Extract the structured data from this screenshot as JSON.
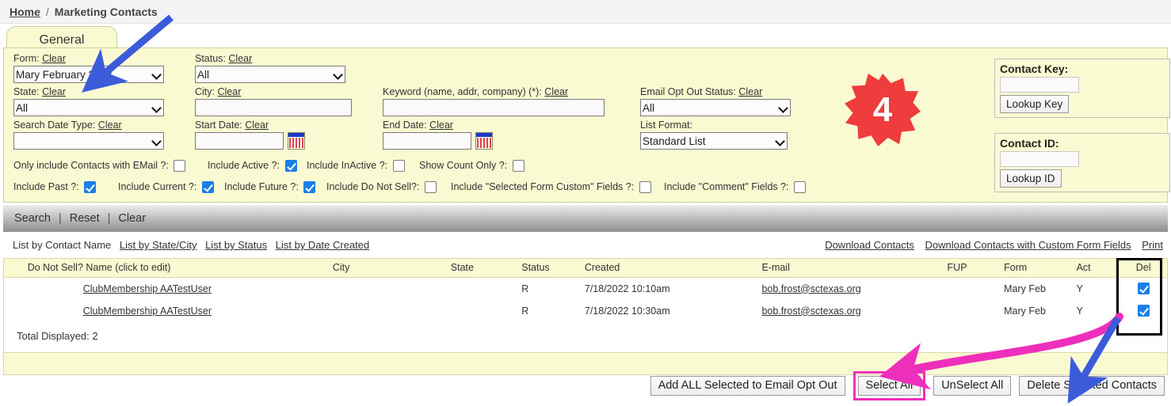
{
  "breadcrumb": {
    "home": "Home",
    "separator": "/",
    "current": "Marketing Contacts"
  },
  "tab": {
    "label": "General"
  },
  "search_form": {
    "form": {
      "label": "Form:",
      "clear": "Clear",
      "value": "Mary February 2023"
    },
    "state": {
      "label": "State:",
      "clear": "Clear",
      "value": "All"
    },
    "search_date_type": {
      "label": "Search Date Type:",
      "clear": "Clear",
      "value": ""
    },
    "status": {
      "label": "Status:",
      "clear": "Clear",
      "value": "All"
    },
    "city": {
      "label": "City:",
      "clear": "Clear",
      "value": ""
    },
    "start_date": {
      "label": "Start Date:",
      "clear": "Clear",
      "value": ""
    },
    "keyword": {
      "label": "Keyword (name, addr, company) (*):",
      "clear": "Clear",
      "value": ""
    },
    "end_date": {
      "label": "End Date:",
      "clear": "Clear",
      "value": ""
    },
    "email_opt_out_status": {
      "label": "Email Opt Out Status:",
      "clear": "Clear",
      "value": "All"
    },
    "list_format": {
      "label": "List Format:",
      "value": "Standard List"
    }
  },
  "checkboxes": {
    "row1": [
      {
        "label": "Only include Contacts with EMail ?:",
        "checked": false
      },
      {
        "label": "Include Active ?:",
        "checked": true
      },
      {
        "label": "Include InActive ?:",
        "checked": false
      },
      {
        "label": "Show Count Only ?:",
        "checked": false
      }
    ],
    "row2": [
      {
        "label": "Include Past ?:",
        "checked": true
      },
      {
        "label": "Include Current ?:",
        "checked": true
      },
      {
        "label": "Include Future ?:",
        "checked": true
      },
      {
        "label": "Include Do Not Sell?:",
        "checked": false
      },
      {
        "label": "Include \"Selected Form Custom\" Fields ?:",
        "checked": false
      },
      {
        "label": "Include \"Comment\" Fields ?:",
        "checked": false
      }
    ]
  },
  "contact_key": {
    "title": "Contact Key:",
    "value": "",
    "button": "Lookup Key"
  },
  "contact_id": {
    "title": "Contact ID:",
    "value": "",
    "button": "Lookup ID"
  },
  "badge": {
    "number": "4",
    "color": "#ef3c3c"
  },
  "action_bar": {
    "search": "Search",
    "separator": "|",
    "reset": "Reset",
    "clear": "Clear"
  },
  "list_links": {
    "left": [
      {
        "label": "List by Contact Name",
        "active": true
      },
      {
        "label": "List by State/City",
        "active": false
      },
      {
        "label": "List by Status",
        "active": false
      },
      {
        "label": "List by Date Created",
        "active": false
      }
    ],
    "right": [
      {
        "label": "Download Contacts"
      },
      {
        "label": "Download Contacts with Custom Form Fields"
      },
      {
        "label": "Print"
      }
    ]
  },
  "table": {
    "columns": [
      "Do Not Sell?",
      "Name (click to edit)",
      "City",
      "State",
      "Status",
      "Created",
      "E-mail",
      "FUP",
      "Form",
      "Act",
      "Del"
    ],
    "rows": [
      {
        "do_not_sell": "",
        "name": "ClubMembership AATestUser",
        "city": "",
        "state": "",
        "status": "R",
        "created": "7/18/2022 10:10am",
        "email": "bob.frost@sctexas.org",
        "fup": "",
        "form": "Mary Feb",
        "act": "Y",
        "del_checked": true
      },
      {
        "do_not_sell": "",
        "name": "ClubMembership AATestUser",
        "city": "",
        "state": "",
        "status": "R",
        "created": "7/18/2022 10:30am",
        "email": "bob.frost@sctexas.org",
        "fup": "",
        "form": "Mary Feb",
        "act": "Y",
        "del_checked": true
      }
    ],
    "total_displayed": "Total Displayed: 2"
  },
  "bottom_buttons": [
    {
      "label": "Add ALL Selected to Email Opt Out",
      "highlighted": false
    },
    {
      "label": "Select All",
      "highlighted": true
    },
    {
      "label": "UnSelect All",
      "highlighted": false
    },
    {
      "label": "Delete Selected Contacts",
      "highlighted": false
    }
  ],
  "annotations": {
    "arrow_blue_top_color": "#3b5bdb",
    "arrow_pink_color": "#ee2fbb",
    "arrow_blue_bottom_color": "#3b5bdb",
    "del_highlight_color": "#000000",
    "select_all_highlight_color": "#ee2fbb"
  }
}
